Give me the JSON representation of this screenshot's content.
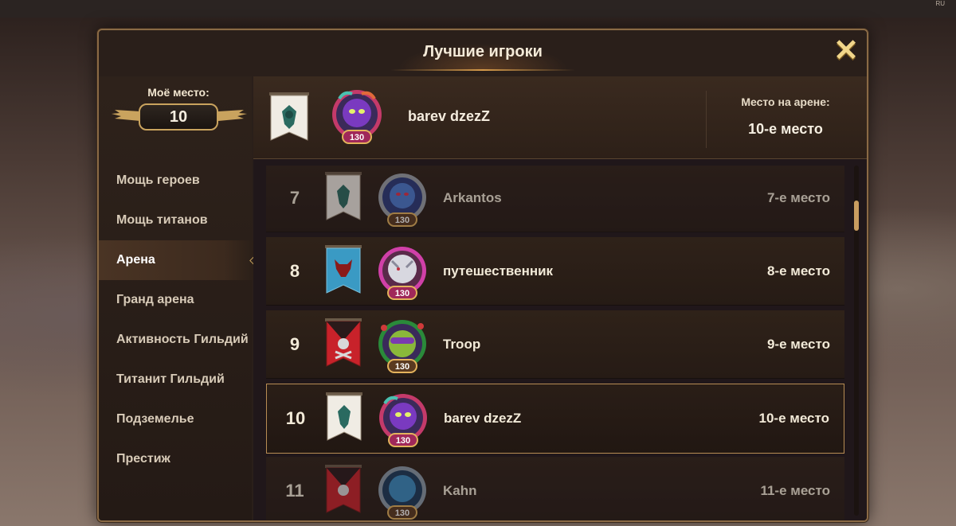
{
  "window": {
    "lang": "RU"
  },
  "panel": {
    "title": "Лучшие игроки",
    "close_icon": "close-x-icon"
  },
  "my_place": {
    "label": "Моё место:",
    "value": "10"
  },
  "menu": {
    "items": [
      {
        "label": "Мощь героев",
        "active": false
      },
      {
        "label": "Мощь титанов",
        "active": false
      },
      {
        "label": "Арена",
        "active": true
      },
      {
        "label": "Гранд арена",
        "active": false
      },
      {
        "label": "Активность Гильдий",
        "active": false
      },
      {
        "label": "Титанит Гильдий",
        "active": false
      },
      {
        "label": "Подземелье",
        "active": false
      },
      {
        "label": "Престиж",
        "active": false
      }
    ]
  },
  "own": {
    "name": "barev dzezZ",
    "level": "130",
    "place_label": "Место на арене:",
    "place_value": "10-е место",
    "banner": "white-banner-teal-emblem",
    "avatar": "purple-hero-avatar"
  },
  "rows": [
    {
      "rank": "7",
      "name": "Arkantos",
      "place": "7-е место",
      "level": "130",
      "banner": "white",
      "avatar": "blue-hero"
    },
    {
      "rank": "8",
      "name": "путешественник",
      "place": "8-е место",
      "level": "130",
      "banner": "blue",
      "avatar": "white-dragon"
    },
    {
      "rank": "9",
      "name": "Troop",
      "place": "9-е место",
      "level": "130",
      "banner": "red",
      "avatar": "green-hero"
    },
    {
      "rank": "10",
      "name": "barev dzezZ",
      "place": "10-е место",
      "level": "130",
      "banner": "white",
      "avatar": "purple-hero"
    },
    {
      "rank": "11",
      "name": "Kahn",
      "place": "11-е место",
      "level": "130",
      "banner": "red",
      "avatar": "blue-beast"
    }
  ],
  "colors": {
    "accent_gold": "#c9a35e",
    "panel_bg": "#2a1f1a",
    "level_badge": "#a0285a",
    "level_badge_ring": "#e3b25c"
  }
}
